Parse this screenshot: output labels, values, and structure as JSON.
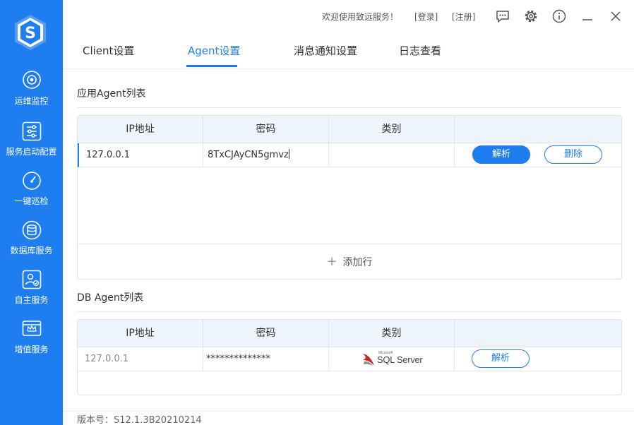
{
  "sidebar": {
    "logo_icon": "shield-s-logo",
    "items": [
      {
        "label": "运维监控",
        "icon": "monitor-eye-icon"
      },
      {
        "label": "服务启动配置",
        "icon": "sliders-icon"
      },
      {
        "label": "一键巡检",
        "icon": "gauge-icon"
      },
      {
        "label": "数据库服务",
        "icon": "database-icon"
      },
      {
        "label": "自主服务",
        "icon": "user-check-icon"
      },
      {
        "label": "增值服务",
        "icon": "crown-screen-icon"
      }
    ],
    "bg_color": "#1e7ef0"
  },
  "topbar": {
    "welcome": "欢迎使用致远服务！",
    "login": "[登录]",
    "register": "[注册]"
  },
  "tabs": [
    {
      "label": "Client设置",
      "active": false
    },
    {
      "label": "Agent设置",
      "active": true
    },
    {
      "label": "消息通知设置",
      "active": false
    },
    {
      "label": "日志查看",
      "active": false
    }
  ],
  "app_agents": {
    "title": "应用Agent列表",
    "headers": [
      "IP地址",
      "密码",
      "类别",
      ""
    ],
    "rows": [
      {
        "ip": "127.0.0.1",
        "password": "8TxCJAyCN5gmvz",
        "type": "",
        "parse_label": "解析",
        "delete_label": "删除"
      }
    ],
    "add_row_label": "添加行"
  },
  "db_agents": {
    "title": "DB Agent列表",
    "headers": [
      "IP地址",
      "密码",
      "类别",
      ""
    ],
    "rows": [
      {
        "ip": "127.0.0.1",
        "password": "**************",
        "type_logo_small": "Microsoft",
        "type_logo": "SQL Server",
        "parse_label": "解析"
      }
    ]
  },
  "version": "版本号：S12.1.3B20210214",
  "accent_color": "#1e7ef0"
}
